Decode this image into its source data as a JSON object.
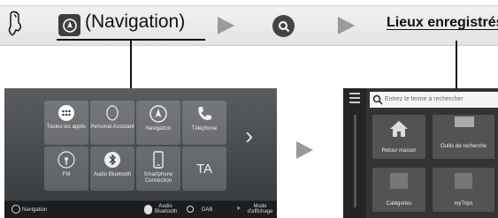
{
  "header": {
    "nav_label": "(Navigation)",
    "destination_label": "Lieux enregistrés"
  },
  "left_screen": {
    "tiles": [
      {
        "label": "Toutes les applis",
        "icon": "grid-dots-icon"
      },
      {
        "label": "Personal Assistant",
        "icon": "assistant-icon"
      },
      {
        "label": "Navigation",
        "icon": "navigation-icon"
      },
      {
        "label": "Téléphone",
        "icon": "phone-icon"
      },
      {
        "label": "FM",
        "icon": "radio-icon"
      },
      {
        "label": "Audio Bluetooth",
        "icon": "bluetooth-icon"
      },
      {
        "label": "Smartphone Connection",
        "icon": "smartphone-icon"
      },
      {
        "label": "TA",
        "icon": "ta-icon"
      }
    ],
    "bottom_bar": {
      "nav": "Navigation",
      "audio_bt": "Audio Bluetooth",
      "dab": "DAB",
      "display_mode": "Mode d'affichage"
    }
  },
  "right_screen": {
    "search_placeholder": "Entrez le terme à rechercher",
    "tiles": [
      {
        "label": "Retour maison",
        "icon": "home-icon"
      },
      {
        "label": "Outils de recherche",
        "icon": "tools-icon"
      },
      {
        "label": "Catégories",
        "icon": "categories-icon"
      },
      {
        "label": "myTrips",
        "icon": "trips-icon"
      }
    ]
  },
  "colors": {
    "arrow": "#9a9a9a",
    "screen": "#3b3e41",
    "line": "#111111"
  }
}
